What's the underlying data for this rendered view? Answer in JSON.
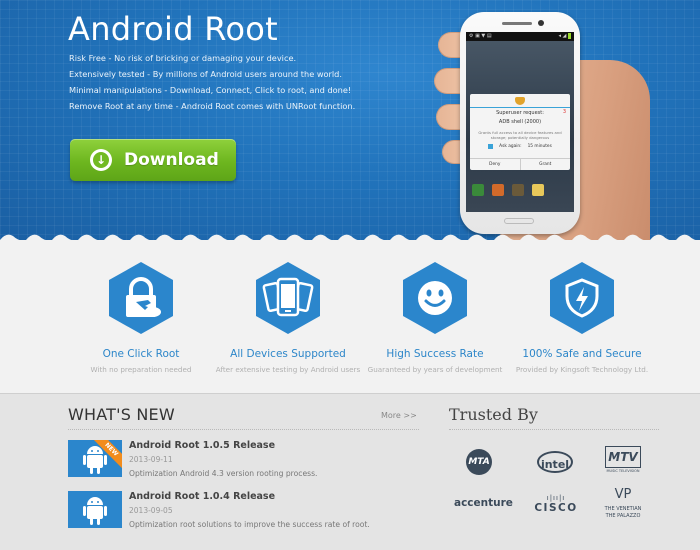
{
  "hero": {
    "title": "Android Root",
    "lines": [
      "Risk Free - No risk of bricking or damaging your device.",
      "Extensively tested - By millions of Android users around the world.",
      "Minimal manipulations - Download, Connect, Click to root, and done!",
      "Remove Root at any time - Android Root comes with UNRoot function."
    ],
    "download_label": "Download",
    "download_icon": "arrow-down-circle-icon",
    "colors": {
      "hero_blue": "#2173bb",
      "download_green": "#6db61f"
    }
  },
  "phone": {
    "dialog": {
      "title": "Superuser request:",
      "count": "3",
      "app": "ADB shell (2000)",
      "description": "Grants full access to all device features and storage; potentially dangerous",
      "ask_again_label": "Ask again:",
      "ask_again_value": "15 minutes",
      "deny_label": "Deny",
      "grant_label": "Grant"
    }
  },
  "features": [
    {
      "icon": "lock-click-icon",
      "title": "One Click Root",
      "subtitle": "With no preparation needed"
    },
    {
      "icon": "devices-icon",
      "title": "All Devices Supported",
      "subtitle": "After extensive testing by Android users"
    },
    {
      "icon": "smiley-icon",
      "title": "High Success Rate",
      "subtitle": "Guaranteed by years of development"
    },
    {
      "icon": "shield-bolt-icon",
      "title": "100% Safe and Secure",
      "subtitle": "Provided by Kingsoft Technology Ltd."
    }
  ],
  "news": {
    "title": "WHAT'S NEW",
    "more_label": "More >>",
    "items": [
      {
        "title": "Android Root 1.0.5 Release",
        "date": "2013-09-11",
        "description": "Optimization Android 4.3 version rooting process.",
        "badge": "NEW"
      },
      {
        "title": "Android Root 1.0.4 Release",
        "date": "2013-09-05",
        "description": "Optimization root solutions to improve the success rate of root."
      }
    ]
  },
  "trusted": {
    "title": "Trusted By",
    "logos": [
      "MTA",
      "intel",
      "MTV",
      "accenture",
      "cisco",
      "VP"
    ],
    "mtv_sub": "MUSIC TELEVISION",
    "vp_sub1": "THE VENETIAN",
    "vp_sub2": "THE PALAZZO"
  }
}
